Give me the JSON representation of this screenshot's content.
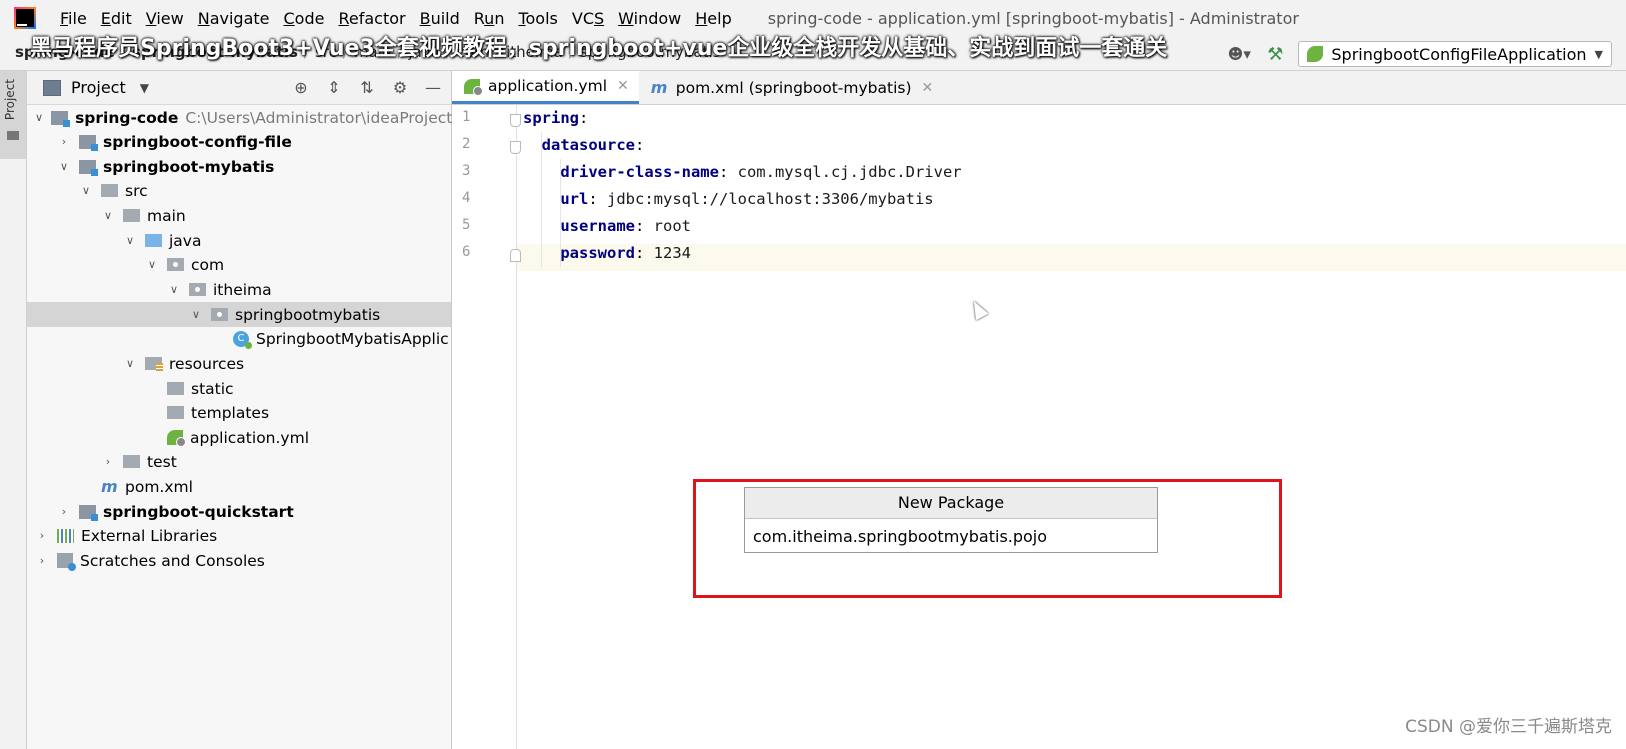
{
  "menubar": {
    "items": [
      {
        "label": "File",
        "mnemonic": "F"
      },
      {
        "label": "Edit",
        "mnemonic": "E"
      },
      {
        "label": "View",
        "mnemonic": "V"
      },
      {
        "label": "Navigate",
        "mnemonic": "N"
      },
      {
        "label": "Code",
        "mnemonic": "C"
      },
      {
        "label": "Refactor",
        "mnemonic": "R"
      },
      {
        "label": "Build",
        "mnemonic": "B"
      },
      {
        "label": "Run",
        "mnemonic": "u"
      },
      {
        "label": "Tools",
        "mnemonic": "T"
      },
      {
        "label": "VCS",
        "mnemonic": "S"
      },
      {
        "label": "Window",
        "mnemonic": "W"
      },
      {
        "label": "Help",
        "mnemonic": "H"
      }
    ],
    "window_title": "spring-code - application.yml [springboot-mybatis] - Administrator"
  },
  "navbar": {
    "breadcrumb": [
      "spring-code",
      "springboot-mybatis",
      "src",
      "main",
      "java",
      "com",
      "itheima",
      "springbootmybatis"
    ],
    "overlay_banner": "黑马程序员SpringBoot3+Vue3全套视频教程，springboot+vue企业级全栈开发从基础、实战到面试一套通关",
    "run_config": "SpringbootConfigFileApplication"
  },
  "tool_stripe": {
    "project_label": "Project"
  },
  "project_panel": {
    "title": "Project",
    "tree": [
      {
        "label": "spring-code",
        "path": "C:\\Users\\Administrator\\ideaProjects\\s"
      },
      {
        "label": "springboot-config-file"
      },
      {
        "label": "springboot-mybatis"
      },
      {
        "label": "src"
      },
      {
        "label": "main"
      },
      {
        "label": "java"
      },
      {
        "label": "com"
      },
      {
        "label": "itheima"
      },
      {
        "label": "springbootmybatis"
      },
      {
        "label": "SpringbootMybatisApplic"
      },
      {
        "label": "resources"
      },
      {
        "label": "static"
      },
      {
        "label": "templates"
      },
      {
        "label": "application.yml"
      },
      {
        "label": "test"
      },
      {
        "label": "pom.xml"
      },
      {
        "label": "springboot-quickstart"
      },
      {
        "label": "External Libraries"
      },
      {
        "label": "Scratches and Consoles"
      }
    ]
  },
  "editor": {
    "tabs": [
      {
        "label": "application.yml"
      },
      {
        "label": "pom.xml (springboot-mybatis)"
      }
    ],
    "lines": [
      {
        "num": "1",
        "key": "spring",
        "value": ""
      },
      {
        "num": "2",
        "key": "datasource",
        "value": ""
      },
      {
        "num": "3",
        "key": "driver-class-name",
        "value": "com.mysql.cj.jdbc.Driver"
      },
      {
        "num": "4",
        "key": "url",
        "value": "jdbc:mysql://localhost:3306/mybatis"
      },
      {
        "num": "5",
        "key": "username",
        "value": "root"
      },
      {
        "num": "6",
        "key": "password",
        "value": "1234"
      }
    ]
  },
  "dialog": {
    "title": "New Package",
    "value": "com.itheima.springbootmybatis.pojo"
  },
  "watermark": "CSDN @爱你三千遍斯塔克",
  "colors": {
    "highlight_border": "#e0121a",
    "tab_underline": "#4083c9",
    "yaml_key": "#000080"
  }
}
